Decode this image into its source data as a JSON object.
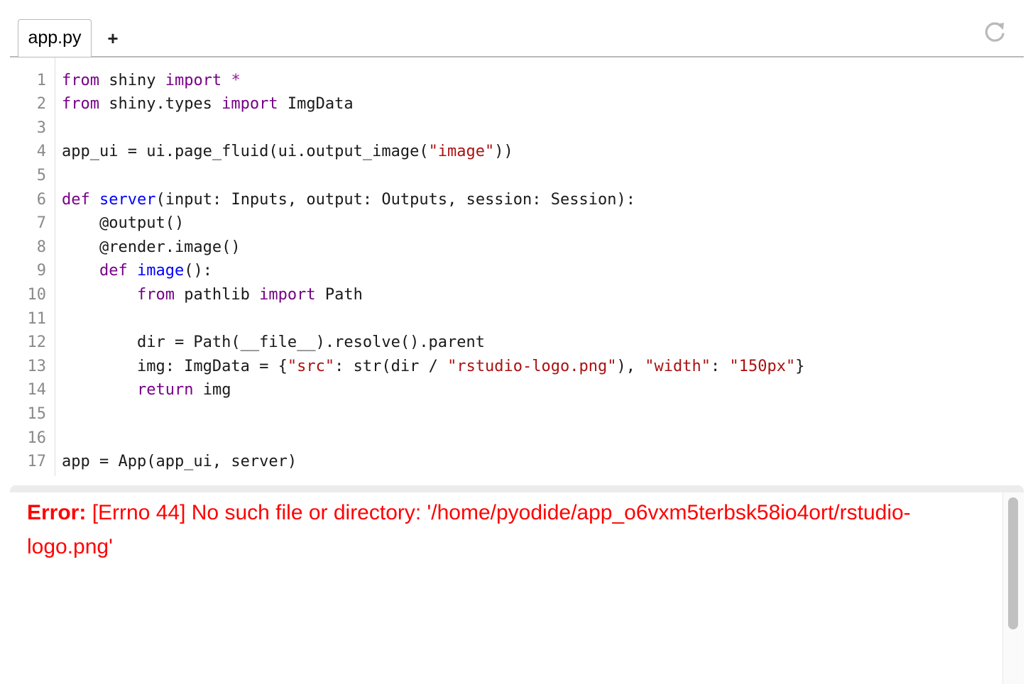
{
  "tabs": [
    {
      "label": "app.py",
      "active": true
    }
  ],
  "add_tab_label": "+",
  "reload_icon": "reload-icon",
  "editor": {
    "line_numbers": [
      "1",
      "2",
      "3",
      "4",
      "5",
      "6",
      "7",
      "8",
      "9",
      "10",
      "11",
      "12",
      "13",
      "14",
      "15",
      "16",
      "17"
    ],
    "lines": [
      [
        {
          "t": "from",
          "c": "kw"
        },
        {
          "t": " shiny ",
          "c": ""
        },
        {
          "t": "import",
          "c": "kw"
        },
        {
          "t": " ",
          "c": ""
        },
        {
          "t": "*",
          "c": "op"
        }
      ],
      [
        {
          "t": "from",
          "c": "kw"
        },
        {
          "t": " shiny.types ",
          "c": ""
        },
        {
          "t": "import",
          "c": "kw"
        },
        {
          "t": " ImgData",
          "c": ""
        }
      ],
      [],
      [
        {
          "t": "app_ui = ui.page_fluid(ui.output_image(",
          "c": ""
        },
        {
          "t": "\"image\"",
          "c": "str"
        },
        {
          "t": "))",
          "c": ""
        }
      ],
      [],
      [
        {
          "t": "def",
          "c": "kw"
        },
        {
          "t": " ",
          "c": ""
        },
        {
          "t": "server",
          "c": "def"
        },
        {
          "t": "(input: Inputs, output: Outputs, session: Session):",
          "c": ""
        }
      ],
      [
        {
          "t": "    @output()",
          "c": ""
        }
      ],
      [
        {
          "t": "    @render.image()",
          "c": ""
        }
      ],
      [
        {
          "t": "    ",
          "c": ""
        },
        {
          "t": "def",
          "c": "kw"
        },
        {
          "t": " ",
          "c": ""
        },
        {
          "t": "image",
          "c": "def"
        },
        {
          "t": "():",
          "c": ""
        }
      ],
      [
        {
          "t": "        ",
          "c": ""
        },
        {
          "t": "from",
          "c": "kw"
        },
        {
          "t": " pathlib ",
          "c": ""
        },
        {
          "t": "import",
          "c": "kw"
        },
        {
          "t": " Path",
          "c": ""
        }
      ],
      [],
      [
        {
          "t": "        dir = Path(__file__).resolve().parent",
          "c": ""
        }
      ],
      [
        {
          "t": "        img: ImgData = {",
          "c": ""
        },
        {
          "t": "\"src\"",
          "c": "str"
        },
        {
          "t": ": str(dir / ",
          "c": ""
        },
        {
          "t": "\"rstudio-logo.png\"",
          "c": "str"
        },
        {
          "t": "), ",
          "c": ""
        },
        {
          "t": "\"width\"",
          "c": "str"
        },
        {
          "t": ": ",
          "c": ""
        },
        {
          "t": "\"150px\"",
          "c": "str"
        },
        {
          "t": "}",
          "c": ""
        }
      ],
      [
        {
          "t": "        ",
          "c": ""
        },
        {
          "t": "return",
          "c": "kw"
        },
        {
          "t": " img",
          "c": ""
        }
      ],
      [],
      [],
      [
        {
          "t": "app = App(app_ui, server)",
          "c": ""
        }
      ]
    ]
  },
  "output": {
    "error_label": "Error:",
    "error_message": " [Errno 44] No such file or directory: '/home/pyodide/app_o6vxm5terbsk58io4ort/rstudio-logo.png'"
  }
}
